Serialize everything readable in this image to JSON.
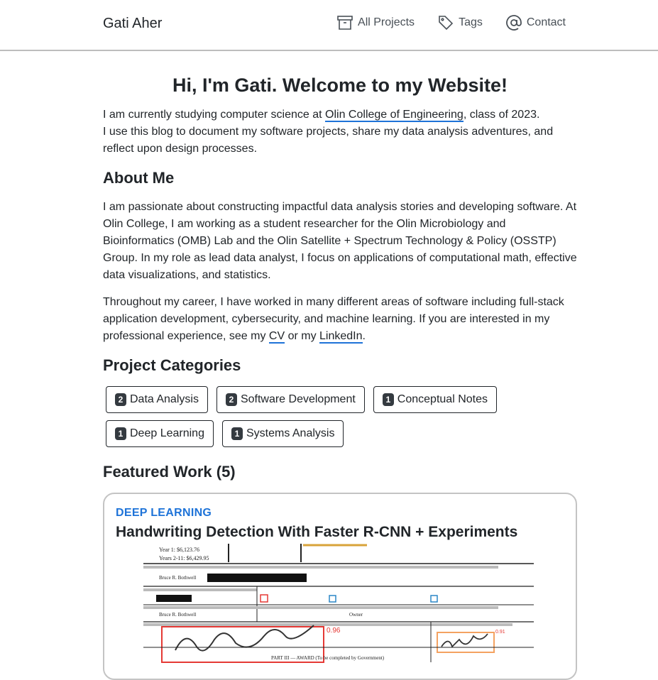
{
  "header": {
    "site_title": "Gati Aher",
    "nav": [
      {
        "label": "All Projects",
        "icon": "archive-icon"
      },
      {
        "label": "Tags",
        "icon": "tag-icon"
      },
      {
        "label": "Contact",
        "icon": "at-sign-icon"
      }
    ]
  },
  "intro": {
    "heading": "Hi, I'm Gati. Welcome to my Website!",
    "p1_pre": "I am currently studying computer science at ",
    "p1_link": "Olin College of Engineering",
    "p1_post": ", class of 2023.",
    "p2": "I use this blog to document my software projects, share my data analysis adventures, and reflect upon design processes."
  },
  "about": {
    "heading": "About Me",
    "p1": "I am passionate about constructing impactful data analysis stories and developing software. At Olin College, I am working as a student researcher for the Olin Microbiology and Bioinformatics (OMB) Lab and the Olin Satellite + Spectrum Technology & Policy (OSSTP) Group. In my role as lead data analyst, I focus on applications of computational math, effective data visualizations, and statistics.",
    "p2_pre": "Throughout my career, I have worked in many different areas of software including full-stack application development, cybersecurity, and machine learning. If you are interested in my professional experience, see my ",
    "cv_link": "CV",
    "p2_mid": " or my ",
    "linkedin_link": "LinkedIn",
    "p2_post": "."
  },
  "categories": {
    "heading": "Project Categories",
    "items": [
      {
        "count": "2",
        "label": "Data Analysis"
      },
      {
        "count": "2",
        "label": "Software Development"
      },
      {
        "count": "1",
        "label": "Conceptual Notes"
      },
      {
        "count": "1",
        "label": "Deep Learning"
      },
      {
        "count": "1",
        "label": "Systems Analysis"
      }
    ]
  },
  "featured": {
    "heading": "Featured Work (5)",
    "card": {
      "category": "DEEP LEARNING",
      "title": "Handwriting Detection With Faster R-CNN + Experiments",
      "thumb": {
        "year1": "Year 1: $6,123.76",
        "years": "Years 2-11: $6,429.95",
        "name": "Bruce R. Bothwell",
        "owner": "Owner",
        "score1": "0.96",
        "score2": "0.91",
        "part": "PART III — AWARD (To be completed by Government)"
      }
    },
    "colors": {
      "accent": "#1e73d8",
      "box_red": "#e53935",
      "box_orange": "#f4a261"
    }
  }
}
